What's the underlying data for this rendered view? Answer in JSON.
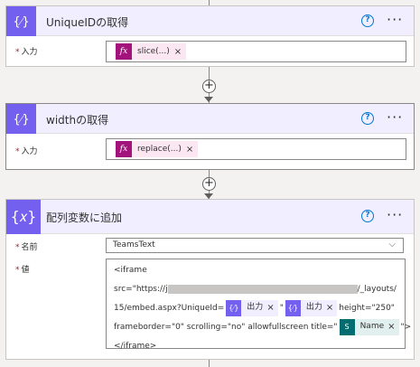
{
  "card1": {
    "title": "UniqueIDの取得",
    "input_label": "入力",
    "token_label": "slice(...)",
    "token_remove": "×",
    "help": "?",
    "more": "···"
  },
  "card2": {
    "title": "widthの取得",
    "input_label": "入力",
    "token_label": "replace(...)",
    "token_remove": "×",
    "help": "?",
    "more": "···"
  },
  "card3": {
    "title": "配列変数に追加",
    "name_label": "名前",
    "name_value": "TeamsText",
    "value_label": "値",
    "help": "?",
    "more": "···",
    "value_lines": {
      "l1": "<iframe",
      "l2a": "src=\"https://j",
      "l2b": "/_layouts/",
      "l3a": "15/embed.aspx?UniqueId=",
      "l3b": "\"",
      "l3c": "height=\"250\"",
      "l4a": "frameborder=\"0\" scrolling=\"no\" allowfullscreen title=\"",
      "l4b": "\">",
      "l5": "</iframe>"
    },
    "tokens": {
      "output1": "出力",
      "output2": "出力",
      "name": "Name",
      "remove": "×"
    }
  },
  "icons": {
    "variable_tile": "{𝑥}",
    "compose_tile": "{⁄}",
    "fx": "fx",
    "sharepoint": "S"
  },
  "colors": {
    "variable_purple": "#7460ee",
    "expression_magenta": "#a3137c",
    "sharepoint_teal": "#036c70",
    "required_red": "#a4262c",
    "help_blue": "#0078d4"
  }
}
